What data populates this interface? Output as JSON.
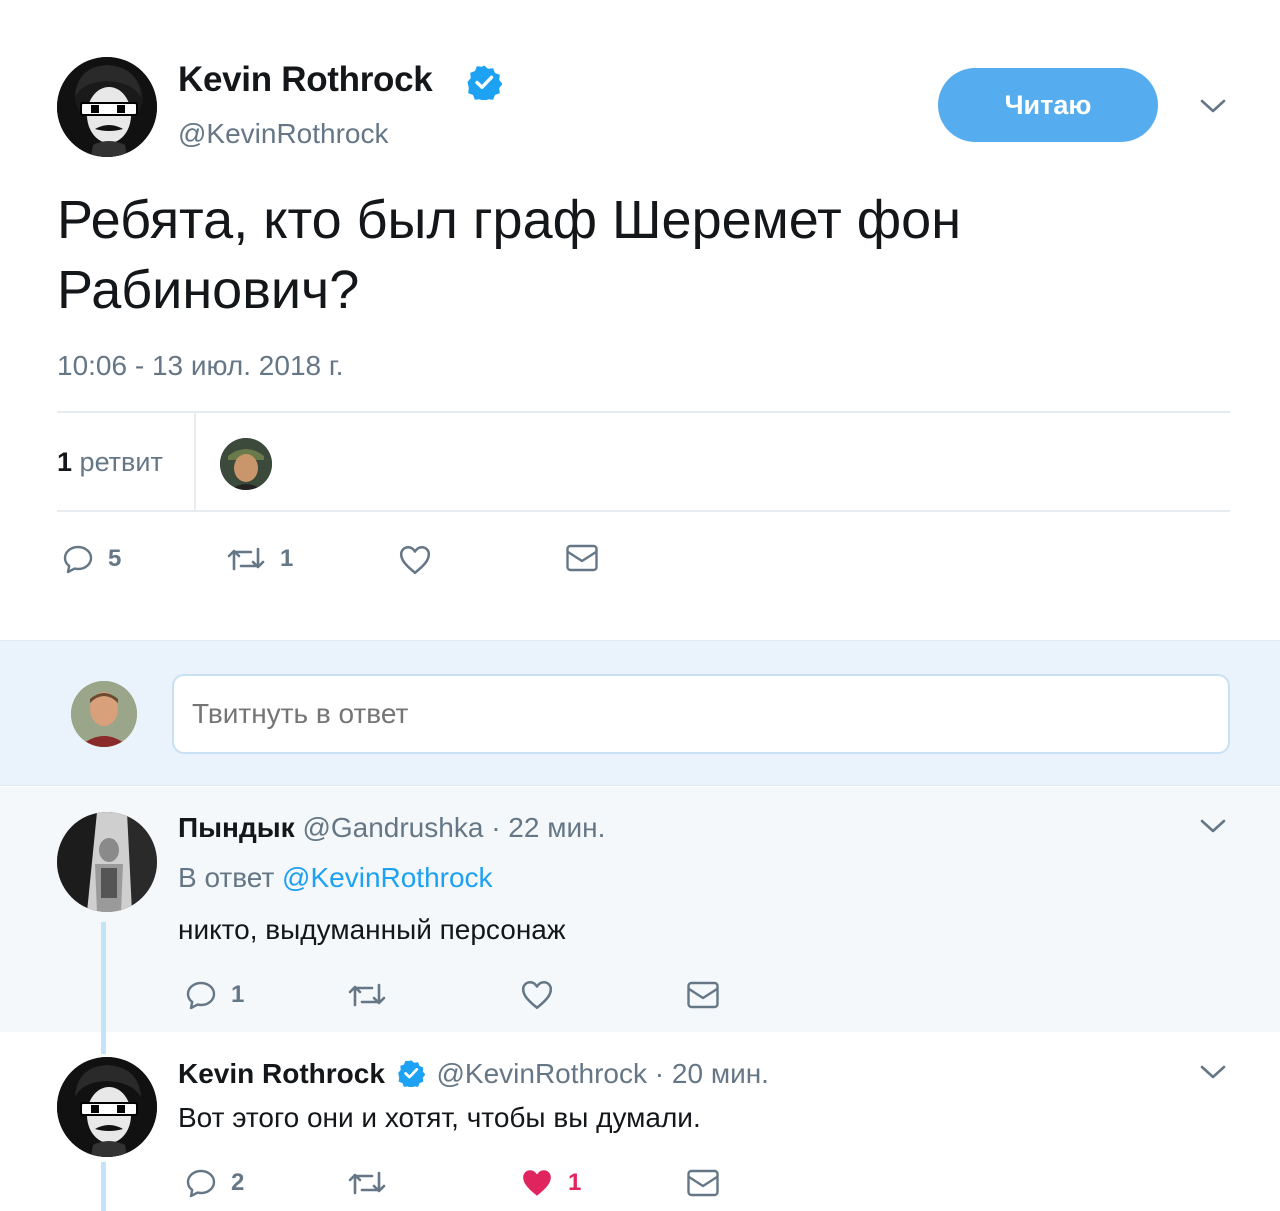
{
  "tweet": {
    "author_name": "Kevin Rothrock",
    "author_handle": "@KevinRothrock",
    "follow_label": "Читаю",
    "text": "Ребята, кто был граф Шеремет фон Рабинович?",
    "timestamp": "10:06 - 13 июл. 2018 г.",
    "retweets_count": "1",
    "retweets_label": "ретвит",
    "actions": {
      "replies": "5",
      "retweets": "1",
      "likes": ""
    }
  },
  "reply_box": {
    "placeholder": "Твитнуть в ответ"
  },
  "replies": [
    {
      "author_name": "Пындык",
      "author_handle": "@Gandrushka",
      "time": "· 22 мин.",
      "reply_to_prefix": "В ответ",
      "reply_to_handle": "@KevinRothrock",
      "text": "никто, выдуманный персонаж",
      "actions": {
        "replies": "1",
        "retweets": "",
        "likes": ""
      }
    },
    {
      "author_name": "Kevin Rothrock",
      "author_handle": "@KevinRothrock",
      "time": "· 20 мин.",
      "text": "Вот этого они и хотят, чтобы вы думали.",
      "actions": {
        "replies": "2",
        "retweets": "",
        "likes": "1",
        "liked": true
      }
    }
  ],
  "colors": {
    "accent": "#55acee",
    "link": "#1da1f2",
    "secondary": "#657786",
    "liked": "#e0245e",
    "verified": "#1da1f2"
  }
}
